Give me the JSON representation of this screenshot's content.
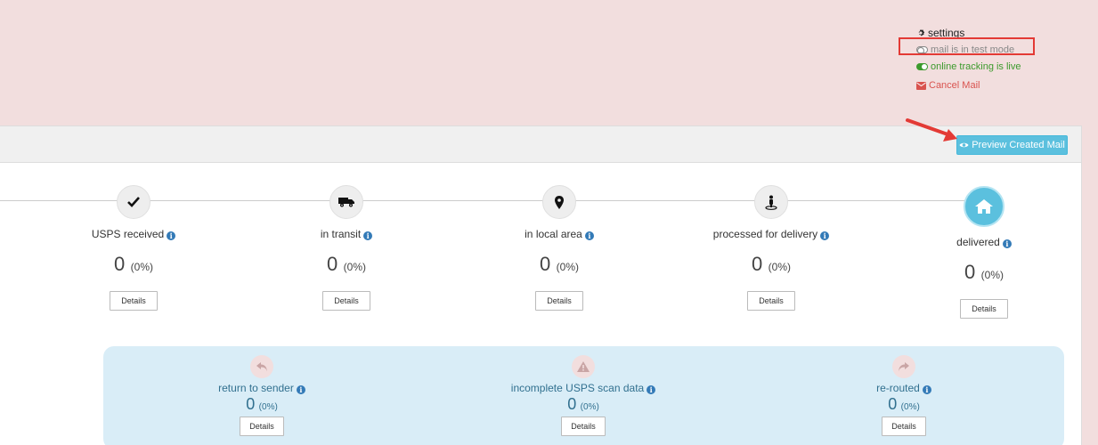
{
  "top_links": {
    "settings": "settings",
    "test_mode": "mail is in test mode",
    "tracking_live": "online tracking is live",
    "cancel_mail": "Cancel Mail"
  },
  "header": {
    "preview_button": "Preview Created Mail"
  },
  "steps": [
    {
      "label": "USPS received",
      "count": "0",
      "percent": "(0%)",
      "details": "Details",
      "icon": "check-icon"
    },
    {
      "label": "in transit",
      "count": "0",
      "percent": "(0%)",
      "details": "Details",
      "icon": "truck-icon"
    },
    {
      "label": "in local area",
      "count": "0",
      "percent": "(0%)",
      "details": "Details",
      "icon": "map-marker-icon"
    },
    {
      "label": "processed for delivery",
      "count": "0",
      "percent": "(0%)",
      "details": "Details",
      "icon": "person-pin-icon"
    },
    {
      "label": "delivered",
      "count": "0",
      "percent": "(0%)",
      "details": "Details",
      "icon": "home-icon"
    }
  ],
  "exceptions": [
    {
      "label": "return to sender",
      "count": "0",
      "percent": "(0%)",
      "details": "Details",
      "icon": "reply-icon"
    },
    {
      "label": "incomplete USPS scan data",
      "count": "0",
      "percent": "(0%)",
      "details": "Details",
      "icon": "warning-icon"
    },
    {
      "label": "re-routed",
      "count": "0",
      "percent": "(0%)",
      "details": "Details",
      "icon": "forward-icon"
    }
  ],
  "colors": {
    "background": "#f2dede",
    "accent": "#5bc0de",
    "live": "#3c9a2c",
    "cancel": "#d9534f",
    "annotation": "#e33a35"
  }
}
